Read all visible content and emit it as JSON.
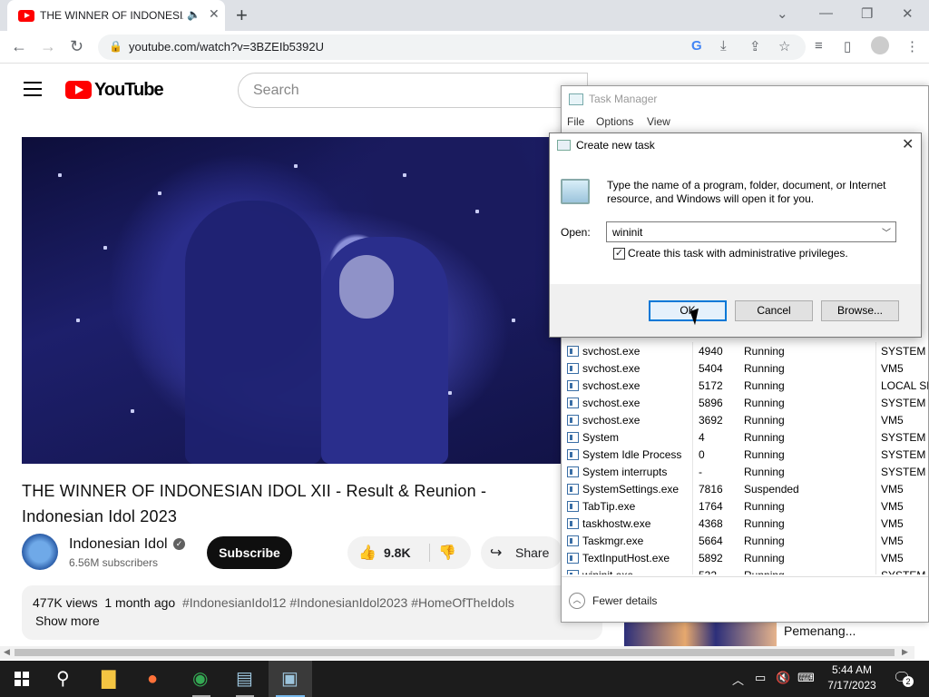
{
  "browser": {
    "tab_title": "THE WINNER OF INDONESIA",
    "tab_audio_icon": "speaker-icon",
    "url": "youtube.com/watch?v=3BZEIb5392U"
  },
  "youtube": {
    "logo_text": "YouTube",
    "search_placeholder": "Search",
    "video_title": "THE WINNER OF INDONESIAN IDOL XII - Result & Reunion - Indonesian Idol 2023",
    "channel_name": "Indonesian Idol",
    "subscribers": "6.56M subscribers",
    "subscribe_label": "Subscribe",
    "likes": "9.8K",
    "share_label": "Share",
    "views": "477K views",
    "posted": "1 month ago",
    "hashtags": "#IndonesianIdol12 #IndonesianIdol2023 #HomeOfTheIdols",
    "show_more": "Show more",
    "side_video_title": "Pemenang..."
  },
  "task_manager": {
    "title": "Task Manager",
    "menu": [
      "File",
      "Options",
      "View"
    ],
    "processes": [
      {
        "name": "svchost.exe",
        "pid": "4940",
        "status": "Running",
        "user": "SYSTEM"
      },
      {
        "name": "svchost.exe",
        "pid": "5404",
        "status": "Running",
        "user": "VM5"
      },
      {
        "name": "svchost.exe",
        "pid": "5172",
        "status": "Running",
        "user": "LOCAL SE"
      },
      {
        "name": "svchost.exe",
        "pid": "5896",
        "status": "Running",
        "user": "SYSTEM"
      },
      {
        "name": "svchost.exe",
        "pid": "3692",
        "status": "Running",
        "user": "VM5"
      },
      {
        "name": "System",
        "pid": "4",
        "status": "Running",
        "user": "SYSTEM"
      },
      {
        "name": "System Idle Process",
        "pid": "0",
        "status": "Running",
        "user": "SYSTEM"
      },
      {
        "name": "System interrupts",
        "pid": "-",
        "status": "Running",
        "user": "SYSTEM"
      },
      {
        "name": "SystemSettings.exe",
        "pid": "7816",
        "status": "Suspended",
        "user": "VM5"
      },
      {
        "name": "TabTip.exe",
        "pid": "1764",
        "status": "Running",
        "user": "VM5"
      },
      {
        "name": "taskhostw.exe",
        "pid": "4368",
        "status": "Running",
        "user": "VM5"
      },
      {
        "name": "Taskmgr.exe",
        "pid": "5664",
        "status": "Running",
        "user": "VM5"
      },
      {
        "name": "TextInputHost.exe",
        "pid": "5892",
        "status": "Running",
        "user": "VM5"
      },
      {
        "name": "wininit.exe",
        "pid": "532",
        "status": "Running",
        "user": "SYSTEM"
      }
    ],
    "fewer_details": "Fewer details"
  },
  "run_dialog": {
    "title": "Create new task",
    "prompt": "Type the name of a program, folder, document, or Internet resource, and Windows will open it for you.",
    "open_label": "Open:",
    "open_value": "wininit",
    "admin_checkbox_label": "Create this task with administrative privileges.",
    "admin_checked": true,
    "ok_label": "OK",
    "cancel_label": "Cancel",
    "browse_label": "Browse..."
  },
  "taskbar": {
    "time": "5:44 AM",
    "date": "7/17/2023",
    "notification_count": "2"
  },
  "colors": {
    "youtube_red": "#ff0000",
    "accent_blue": "#0078d7",
    "taskbar_bg": "#1c1c1c"
  }
}
